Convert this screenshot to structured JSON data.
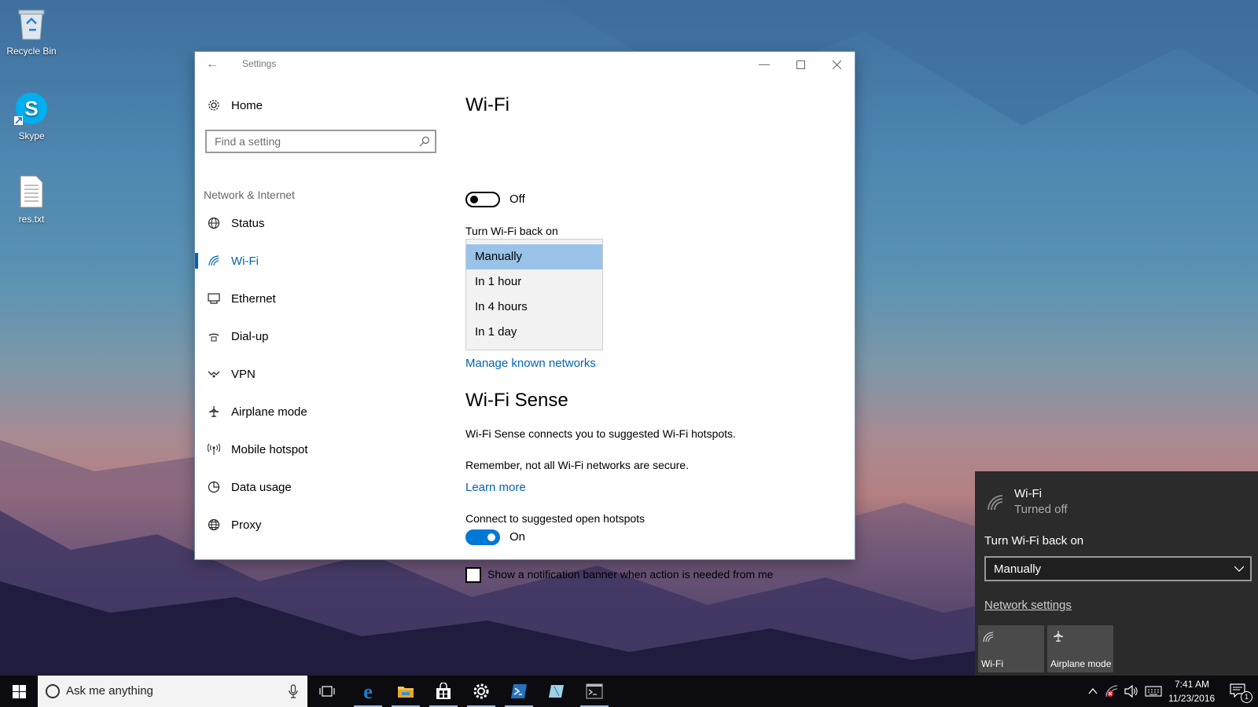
{
  "desktop": {
    "icons": [
      {
        "label": "Recycle Bin"
      },
      {
        "label": "Skype"
      },
      {
        "label": "res.txt"
      }
    ]
  },
  "window": {
    "title": "Settings",
    "nav": {
      "home": "Home",
      "search_placeholder": "Find a setting",
      "section": "Network & Internet",
      "items": [
        {
          "label": "Status",
          "icon": "globe-icon"
        },
        {
          "label": "Wi-Fi",
          "icon": "wifi-icon",
          "active": true
        },
        {
          "label": "Ethernet",
          "icon": "ethernet-icon"
        },
        {
          "label": "Dial-up",
          "icon": "dialup-icon"
        },
        {
          "label": "VPN",
          "icon": "vpn-icon"
        },
        {
          "label": "Airplane mode",
          "icon": "airplane-icon"
        },
        {
          "label": "Mobile hotspot",
          "icon": "hotspot-icon"
        },
        {
          "label": "Data usage",
          "icon": "data-usage-icon"
        },
        {
          "label": "Proxy",
          "icon": "proxy-globe-icon"
        }
      ]
    },
    "content": {
      "wifi_heading": "Wi-Fi",
      "wifi_toggle_state": "Off",
      "turn_back_label": "Turn Wi-Fi back on",
      "turn_back_options": [
        "Manually",
        "In 1 hour",
        "In 4 hours",
        "In 1 day"
      ],
      "turn_back_selected": "Manually",
      "manage_link": "Manage known networks",
      "sense_heading": "Wi-Fi Sense",
      "sense_desc": "Wi-Fi Sense connects you to suggested Wi-Fi hotspots.",
      "sense_warning": "Remember, not all Wi-Fi networks are secure.",
      "learn_more": "Learn more",
      "hotspots_label": "Connect to suggested open hotspots",
      "hotspots_state": "On",
      "banner_checkbox": "Show a notification banner when action is needed from me"
    }
  },
  "flyout": {
    "title": "Wi-Fi",
    "subtitle": "Turned off",
    "turn_back_label": "Turn Wi-Fi back on",
    "turn_back_value": "Manually",
    "network_settings": "Network settings",
    "tiles": [
      {
        "label": "Wi-Fi"
      },
      {
        "label": "Airplane mode"
      }
    ]
  },
  "taskbar": {
    "search_text": "Ask me anything",
    "time": "7:41 AM",
    "date": "11/23/2016",
    "notification_count": "1"
  },
  "colors": {
    "accent": "#0078d7",
    "link": "#0063b1",
    "selected_option": "#99c3e8",
    "flyout_bg": "#2b2b2b"
  }
}
